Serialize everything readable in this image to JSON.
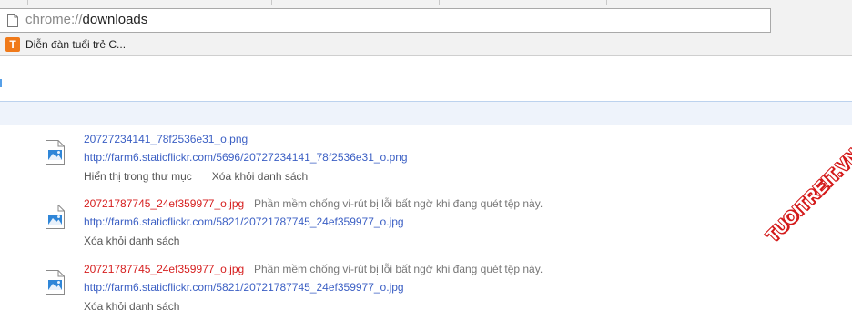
{
  "browser": {
    "omnibox": {
      "scheme": "chrome://",
      "path": "downloads"
    },
    "bookmarks": [
      {
        "icon": "T",
        "label": "Diễn đàn tuổi trẻ C..."
      }
    ]
  },
  "downloads": [
    {
      "filename": "20727234141_78f2536e31_o.png",
      "url": "http://farm6.staticflickr.com/5696/20727234141_78f2536e31_o.png",
      "warning": "",
      "dangerous": false,
      "actions": [
        "Hiển thị trong thư mục",
        "Xóa khỏi danh sách"
      ]
    },
    {
      "filename": "20721787745_24ef359977_o.jpg",
      "url": "http://farm6.staticflickr.com/5821/20721787745_24ef359977_o.jpg",
      "warning": "Phần mềm chống vi-rút bị lỗi bất ngờ khi đang quét tệp này.",
      "dangerous": true,
      "actions": [
        "Xóa khỏi danh sách"
      ]
    },
    {
      "filename": "20721787745_24ef359977_o.jpg",
      "url": "http://farm6.staticflickr.com/5821/20721787745_24ef359977_o.jpg",
      "warning": "Phần mềm chống vi-rút bị lỗi bất ngờ khi đang quét tệp này.",
      "dangerous": true,
      "actions": [
        "Xóa khỏi danh sách"
      ]
    }
  ],
  "watermark": "TUOITREIT.VN",
  "colors": {
    "link": "#3b5fc4",
    "danger": "#d62020",
    "accent": "#57a0e8"
  },
  "icons": {
    "omnibox": "page-icon",
    "file": "image-file-icon",
    "bookmark": "tuoitre-favicon"
  }
}
